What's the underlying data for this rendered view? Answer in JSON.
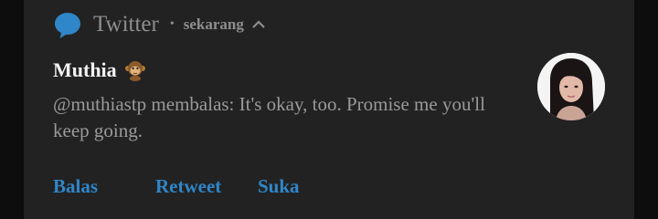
{
  "notification": {
    "app_icon": "speech-bubble-icon",
    "app_name": "Twitter",
    "separator": "•",
    "time": "sekarang",
    "collapse_icon": "chevron-up-icon",
    "title": "Muthia",
    "title_emoji": "monkey-icon",
    "body": "@muthiastp membalas: It's okay, too. Promise me you'll keep going.",
    "avatar": "profile-photo-avatar",
    "accent_color": "#2f86c8",
    "actions": [
      {
        "label": "Balas"
      },
      {
        "label": "Retweet"
      },
      {
        "label": "Suka"
      }
    ]
  }
}
